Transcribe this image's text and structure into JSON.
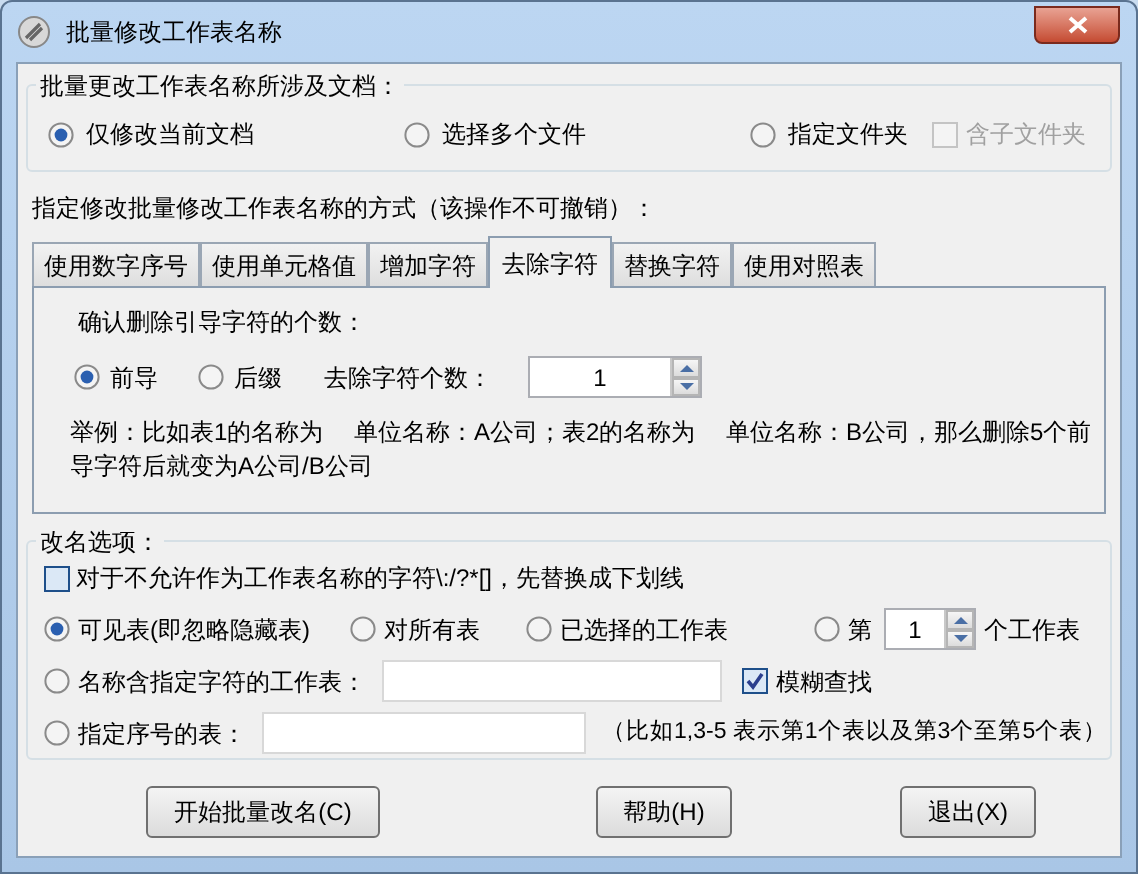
{
  "window": {
    "title": "批量修改工作表名称"
  },
  "doc_scope": {
    "legend": "批量更改工作表名称所涉及文档：",
    "options": [
      {
        "label": "仅修改当前文档",
        "selected": true
      },
      {
        "label": "选择多个文件",
        "selected": false
      },
      {
        "label": "指定文件夹",
        "selected": false
      }
    ],
    "include_subfolders": {
      "label": "含子文件夹",
      "checked": false,
      "disabled": true
    }
  },
  "method_label": "指定修改批量修改工作表名称的方式（该操作不可撤销）：",
  "tabs": [
    {
      "label": "使用数字序号",
      "selected": false
    },
    {
      "label": "使用单元格值",
      "selected": false
    },
    {
      "label": "增加字符",
      "selected": false
    },
    {
      "label": "去除字符",
      "selected": true
    },
    {
      "label": "替换字符",
      "selected": false
    },
    {
      "label": "使用对照表",
      "selected": false
    }
  ],
  "tab_panel": {
    "prompt": "确认删除引导字符的个数：",
    "position_options": [
      {
        "label": "前导",
        "selected": true
      },
      {
        "label": "后缀",
        "selected": false
      }
    ],
    "count_label": "去除字符个数：",
    "count_value": "1",
    "example": "举例：比如表1的名称为　 单位名称：A公司；表2的名称为　 单位名称：B公司，那么删除5个前导字符后就变为A公司/B公司"
  },
  "rename_options": {
    "legend": "改名选项：",
    "replace_invalid": {
      "label": "对于不允许作为工作表名称的字符\\:/?*[]，先替换成下划线",
      "checked": false
    },
    "rows": [
      [
        {
          "kind": "radio",
          "label": "可见表(即忽略隐藏表)",
          "selected": true
        },
        {
          "kind": "radio",
          "label": "对所有表",
          "selected": false
        },
        {
          "kind": "radio",
          "label": "已选择的工作表",
          "selected": false
        },
        {
          "kind": "spin_radio",
          "label": "第",
          "selected": false,
          "value": "1",
          "suffix": "个工作表"
        }
      ],
      [
        {
          "kind": "field_radio",
          "label": "名称含指定字符的工作表：",
          "selected": false
        },
        {
          "kind": "checkbox",
          "label": "模糊查找",
          "checked": true
        }
      ],
      [
        {
          "kind": "field_radio",
          "label": "指定序号的表：",
          "selected": false
        },
        {
          "kind": "hint",
          "label": "（比如1,3-5 表示第1个表以及第3个至第5个表）"
        }
      ]
    ]
  },
  "buttons": [
    {
      "label": "开始批量改名(C)"
    },
    {
      "label": "帮助(H)"
    },
    {
      "label": "退出(X)"
    }
  ]
}
